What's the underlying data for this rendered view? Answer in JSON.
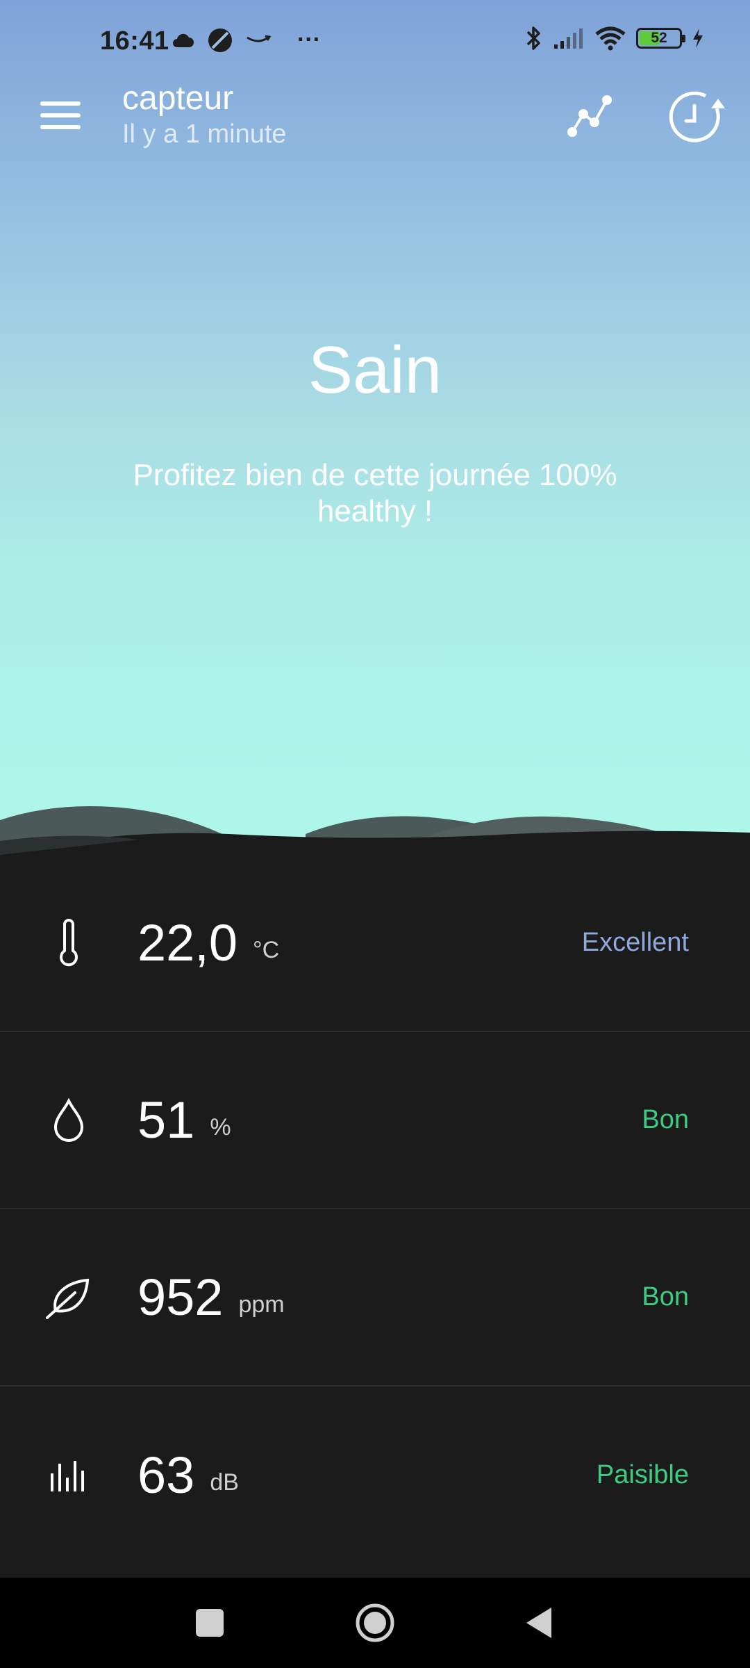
{
  "status_bar": {
    "time": "16:41",
    "more": "···",
    "battery": "52",
    "battery_level": 0.52,
    "icons": [
      "cloud-icon",
      "app-icon",
      "amazon-icon",
      "bluetooth-icon",
      "signal-icon",
      "wifi-icon",
      "battery-icon",
      "charging-icon"
    ]
  },
  "header": {
    "title": "capteur",
    "subtitle": "Il y a 1 minute",
    "icons": [
      "menu-icon",
      "chart-icon",
      "history-icon"
    ]
  },
  "hero": {
    "title": "Sain",
    "message": "Profitez bien de cette journée 100% healthy !"
  },
  "metrics": [
    {
      "icon": "thermometer-icon",
      "value": "22,0",
      "unit": "°C",
      "status": "Excellent",
      "status_color": "#8fa9dc"
    },
    {
      "icon": "droplet-icon",
      "value": "51",
      "unit": "%",
      "status": "Bon",
      "status_color": "#3ecb82"
    },
    {
      "icon": "leaf-icon",
      "value": "952",
      "unit": "ppm",
      "status": "Bon",
      "status_color": "#3ecb82"
    },
    {
      "icon": "sound-icon",
      "value": "63",
      "unit": "dB",
      "status": "Paisible",
      "status_color": "#3ecb82"
    }
  ],
  "colors": {
    "sky_top": "#7fa2d8",
    "sky_bottom": "#aef7ea",
    "panel": "#1b1b1b"
  },
  "nav": {
    "icons": [
      "recents-icon",
      "home-icon",
      "back-icon"
    ]
  }
}
